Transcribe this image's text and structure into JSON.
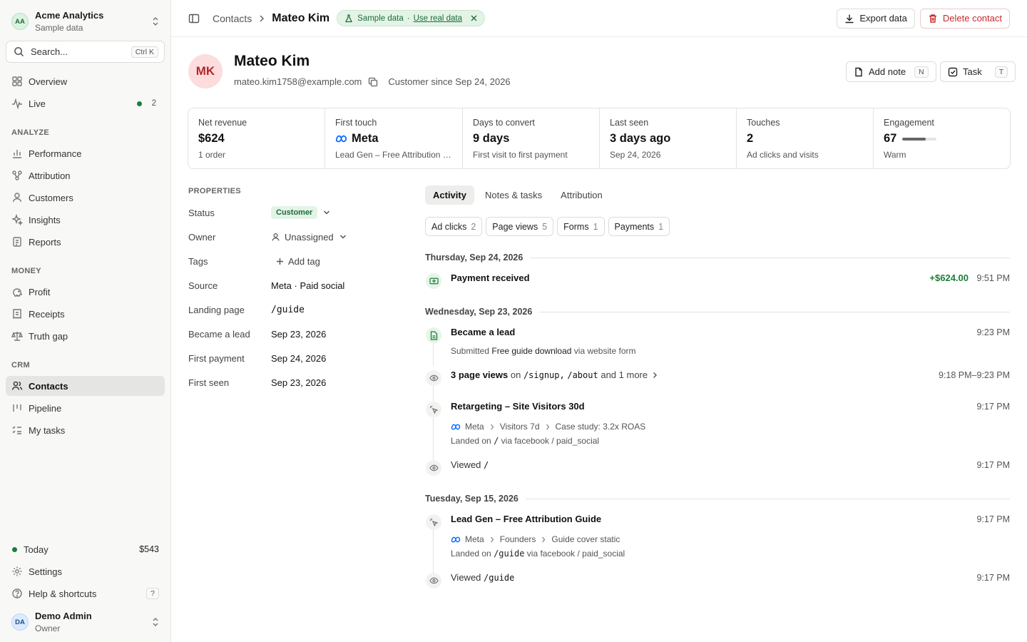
{
  "org": {
    "initials": "AA",
    "name": "Acme Analytics",
    "subtitle": "Sample data"
  },
  "search": {
    "placeholder": "Search...",
    "shortcut": "Ctrl K"
  },
  "nav_top": [
    {
      "label": "Overview",
      "icon": "grid-icon"
    },
    {
      "label": "Live",
      "icon": "pulse-icon",
      "count": "2"
    }
  ],
  "sections": {
    "analyze": "ANALYZE",
    "money": "MONEY",
    "crm": "CRM"
  },
  "nav_analyze": [
    {
      "label": "Performance",
      "icon": "chart-icon"
    },
    {
      "label": "Attribution",
      "icon": "nodes-icon"
    },
    {
      "label": "Customers",
      "icon": "user-icon"
    },
    {
      "label": "Insights",
      "icon": "sparkle-icon"
    },
    {
      "label": "Reports",
      "icon": "doc-icon"
    }
  ],
  "nav_money": [
    {
      "label": "Profit",
      "icon": "piggy-icon"
    },
    {
      "label": "Receipts",
      "icon": "receipt-icon"
    },
    {
      "label": "Truth gap",
      "icon": "scale-icon"
    }
  ],
  "nav_crm": [
    {
      "label": "Contacts",
      "icon": "users-icon",
      "active": true
    },
    {
      "label": "Pipeline",
      "icon": "columns-icon"
    },
    {
      "label": "My tasks",
      "icon": "list-check-icon"
    }
  ],
  "bottom": {
    "today_label": "Today",
    "today_value": "$543",
    "settings": "Settings",
    "help": "Help & shortcuts",
    "help_key": "?"
  },
  "user": {
    "initials": "DA",
    "name": "Demo Admin",
    "role": "Owner"
  },
  "topbar": {
    "crumb_parent": "Contacts",
    "crumb_current": "Mateo Kim",
    "sample_label": "Sample data",
    "sample_sep": "·",
    "sample_link": "Use real data",
    "export_label": "Export data",
    "delete_label": "Delete contact"
  },
  "contact": {
    "initials": "MK",
    "name": "Mateo Kim",
    "email": "mateo.kim1758@example.com",
    "since": "Customer since Sep 24, 2026",
    "add_note_label": "Add note",
    "add_note_key": "N",
    "task_label": "Task",
    "task_key": "T"
  },
  "stats": [
    {
      "label": "Net revenue",
      "value": "$624",
      "sub": "1 order"
    },
    {
      "label": "First touch",
      "value": "Meta",
      "sub": "Lead Gen – Free Attribution Guide",
      "icon": "meta-icon"
    },
    {
      "label": "Days to convert",
      "value": "9 days",
      "sub": "First visit to first payment"
    },
    {
      "label": "Last seen",
      "value": "3 days ago",
      "sub": "Sep 24, 2026"
    },
    {
      "label": "Touches",
      "value": "2",
      "sub": "Ad clicks and visits"
    },
    {
      "label": "Engagement",
      "value": "67",
      "sub": "Warm",
      "score": 67
    }
  ],
  "properties": {
    "heading": "PROPERTIES",
    "rows": [
      {
        "key": "Status",
        "value": "Customer"
      },
      {
        "key": "Owner",
        "value": "Unassigned"
      },
      {
        "key": "Tags",
        "value": "Add tag"
      },
      {
        "key": "Source",
        "value": "Meta · Paid social"
      },
      {
        "key": "Landing page",
        "value": "/guide"
      },
      {
        "key": "Became a lead",
        "value": "Sep 23, 2026"
      },
      {
        "key": "First payment",
        "value": "Sep 24, 2026"
      },
      {
        "key": "First seen",
        "value": "Sep 23, 2026"
      }
    ]
  },
  "tabs": [
    "Activity",
    "Notes & tasks",
    "Attribution"
  ],
  "filters": [
    {
      "label": "Ad clicks",
      "count": "2"
    },
    {
      "label": "Page views",
      "count": "5"
    },
    {
      "label": "Forms",
      "count": "1"
    },
    {
      "label": "Payments",
      "count": "1"
    }
  ],
  "days": [
    "Thursday, Sep 24, 2026",
    "Wednesday, Sep 23, 2026",
    "Tuesday, Sep 15, 2026"
  ],
  "events": {
    "payment": {
      "title": "Payment received",
      "amount": "+$624.00",
      "time": "9:51 PM"
    },
    "lead": {
      "title": "Became a lead",
      "sub_pre": "Submitted",
      "sub_form": "Free guide download",
      "sub_post": "via website form",
      "time": "9:23 PM"
    },
    "pageviews": {
      "title": "3 page views",
      "on": "on",
      "p1": "/signup,",
      "p2": "/about",
      "more": "and 1 more",
      "time": "9:18 PM–9:23 PM"
    },
    "retarget": {
      "title": "Retargeting – Site Visitors 30d",
      "platform": "Meta",
      "adset": "Visitors 7d",
      "ad": "Case study: 3.2x ROAS",
      "landed": "Landed on",
      "path": "/",
      "via": "via facebook / paid_social",
      "time": "9:17 PM"
    },
    "viewed1": {
      "label": "Viewed",
      "path": "/",
      "time": "9:17 PM"
    },
    "leadgen": {
      "title": "Lead Gen – Free Attribution Guide",
      "platform": "Meta",
      "adset": "Founders",
      "ad": "Guide cover static",
      "landed": "Landed on",
      "path": "/guide",
      "via": "via facebook / paid_social",
      "time": "9:17 PM"
    },
    "viewed2": {
      "label": "Viewed",
      "path": "/guide",
      "time": "9:17 PM"
    }
  }
}
